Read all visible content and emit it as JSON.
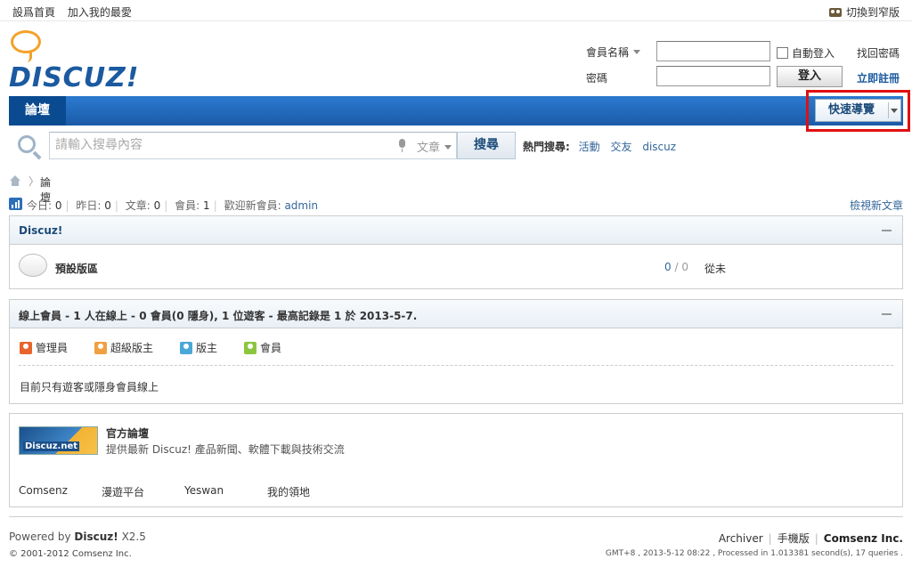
{
  "topbar": {
    "set_home": "設爲首頁",
    "add_fav": "加入我的最愛",
    "switch_width": "切換到窄版"
  },
  "logo": {
    "text": "DISCUZ!"
  },
  "login": {
    "username_label": "會員名稱",
    "password_label": "密碼",
    "username_value": "",
    "password_value": "",
    "auto_login": "自動登入",
    "login_button": "登入",
    "find_password": "找回密碼",
    "register": "立即註冊"
  },
  "nav": {
    "forum_tab": "論壇",
    "quick_nav": "快速導覽"
  },
  "search": {
    "placeholder": "請輸入搜尋內容",
    "type": "文章",
    "button": "搜尋",
    "hot_label": "熱門搜尋:",
    "hot_items": [
      "活動",
      "交友",
      "discuz"
    ]
  },
  "breadcrumb": {
    "separator": "〉",
    "current": "論壇"
  },
  "stats": {
    "today_label": "今日:",
    "today": "0",
    "yesterday_label": "昨日:",
    "yesterday": "0",
    "posts_label": "文章:",
    "posts": "0",
    "members_label": "會員:",
    "members": "1",
    "welcome_label": "歡迎新會員:",
    "new_member": "admin",
    "view_new": "檢視新文章"
  },
  "category": {
    "title": "Discuz!",
    "forum_name": "預設版區",
    "threads": "0",
    "posts": "0",
    "last_post": "從未"
  },
  "online": {
    "title": "線上會員 - 1 人在線上 - 0 會員(0 隱身), 1 位遊客 - 最高記錄是 1 於 2013-5-7.",
    "legend": [
      {
        "label": "管理員",
        "color": "#e8642c"
      },
      {
        "label": "超級版主",
        "color": "#f0a040"
      },
      {
        "label": "版主",
        "color": "#4aa8d8"
      },
      {
        "label": "會員",
        "color": "#8cc63e"
      }
    ],
    "note": "目前只有遊客或隱身會員線上"
  },
  "links": {
    "logo_text": "Discuz.net",
    "title": "官方論壇",
    "desc": "提供最新 Discuz! 產品新聞、軟體下載與技術交流",
    "friends": [
      "Comsenz",
      "漫遊平台",
      "Yeswan",
      "我的領地"
    ]
  },
  "footer": {
    "powered_prefix": "Powered by",
    "powered_name": "Discuz!",
    "version": "X2.5",
    "copyright": "© 2001-2012 Comsenz Inc.",
    "archiver": "Archiver",
    "mobile": "手機版",
    "company": "Comsenz Inc.",
    "processed": "GMT+8 , 2013-5-12 08:22 , Processed in 1.013381 second(s), 17 queries ."
  }
}
